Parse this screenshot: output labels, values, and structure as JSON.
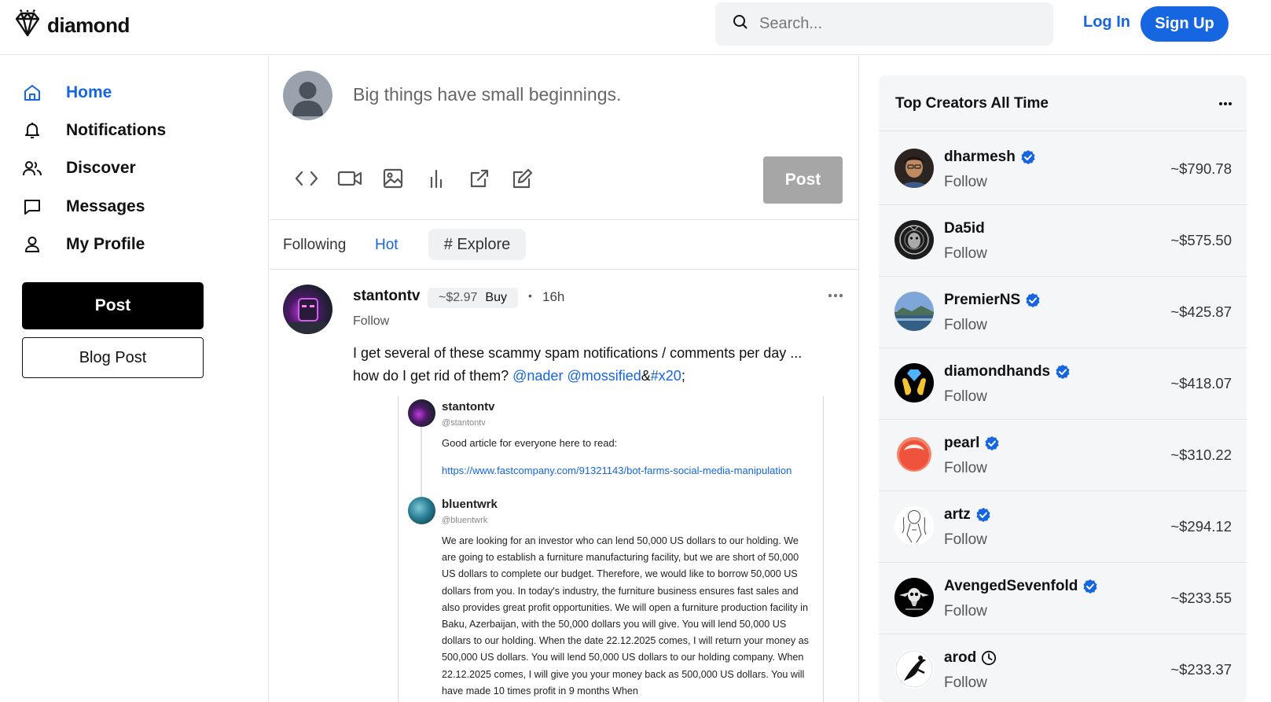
{
  "header": {
    "logo_text": "diamond",
    "search_placeholder": "Search...",
    "login_label": "Log In",
    "signup_label": "Sign Up"
  },
  "nav": {
    "items": [
      {
        "label": "Home",
        "icon": "home-icon",
        "active": true
      },
      {
        "label": "Notifications",
        "icon": "bell-icon"
      },
      {
        "label": "Discover",
        "icon": "users-icon"
      },
      {
        "label": "Messages",
        "icon": "message-icon"
      },
      {
        "label": "My Profile",
        "icon": "user-icon"
      }
    ],
    "post_label": "Post",
    "blog_label": "Blog Post"
  },
  "composer": {
    "placeholder": "Big things have small beginnings.",
    "tools": [
      "code-icon",
      "video-icon",
      "image-icon",
      "poll-icon",
      "external-link-icon",
      "edit-icon"
    ],
    "post_label": "Post"
  },
  "tabs": {
    "following": "Following",
    "hot": "Hot",
    "explore": "# Explore"
  },
  "post": {
    "author": "stantontv",
    "coin_price": "~$2.97",
    "buy_label": "Buy",
    "separator": "•",
    "time": "16h",
    "follow_label": "Follow",
    "body_line1": "I get several of these scammy spam notifications / comments per day ...",
    "body_line2_prefix": "how do I get rid of them? ",
    "mention1": "@nader",
    "mention2": "@mossified",
    "amp": "&",
    "hashtag": "#x20",
    "suffix": ";",
    "embed": {
      "user1_name": "stantontv",
      "user1_handle": "@stantontv",
      "user1_text": "Good article for everyone here to read:",
      "user1_link": "https://www.fastcompany.com/91321143/bot-farms-social-media-manipulation",
      "user2_name": "bluentwrk",
      "user2_handle": "@bluentwrk",
      "user2_text": "We are looking for an investor who can lend 50,000 US dollars to our holding. We are going to establish a furniture manufacturing facility, but we are short of 50,000 US dollars to complete our budget. Therefore, we would like to borrow 50,000 US dollars from you. In today's industry, the furniture business ensures fast sales and also provides great profit opportunities. We will open a furniture production facility in Baku, Azerbaijan, with the 50,000 dollars you will give. You will lend 50,000 US dollars to our holding. When the date 22.12.2025 comes, I will return your money as 500,000 US dollars. You will lend 50,000 US dollars to our holding company. When 22.12.2025 comes, I will give you your money back as 500,000 US dollars. You will have made 10 times profit in 9 months When"
    }
  },
  "top_creators": {
    "title": "Top Creators All Time",
    "follow_label": "Follow",
    "items": [
      {
        "name": "dharmesh",
        "value": "~$790.78",
        "verified": true,
        "badge": "verified-icon"
      },
      {
        "name": "Da5id",
        "value": "~$575.50",
        "verified": false
      },
      {
        "name": "PremierNS",
        "value": "~$425.87",
        "verified": true,
        "badge": "verified-icon"
      },
      {
        "name": "diamondhands",
        "value": "~$418.07",
        "verified": true,
        "badge": "verified-icon"
      },
      {
        "name": "pearl",
        "value": "~$310.22",
        "verified": true,
        "badge": "verified-icon"
      },
      {
        "name": "artz",
        "value": "~$294.12",
        "verified": true,
        "badge": "verified-icon"
      },
      {
        "name": "AvengedSevenfold",
        "value": "~$233.55",
        "verified": true,
        "badge": "verified-icon"
      },
      {
        "name": "arod",
        "value": "~$233.37",
        "verified": false,
        "badge": "clock-icon"
      }
    ]
  },
  "colors": {
    "accent": "#1566e0",
    "post_button_disabled": "#a6a6a6",
    "sidebar_bg": "#f5f6f7"
  }
}
